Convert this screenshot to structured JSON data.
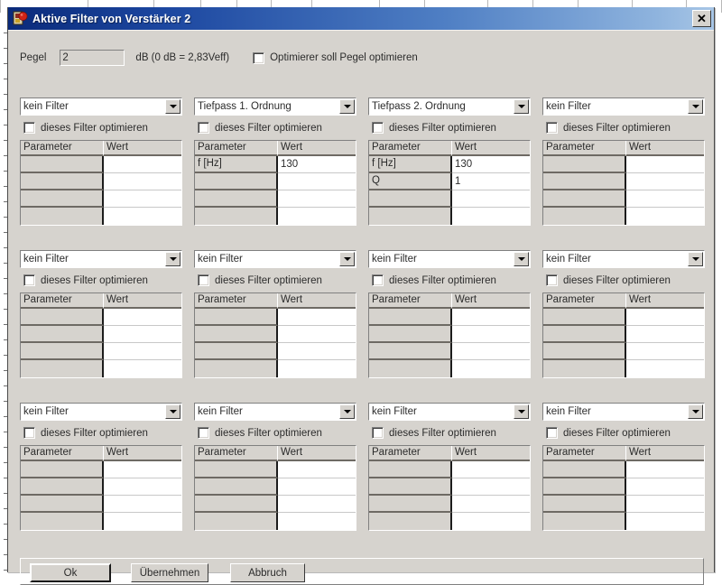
{
  "window": {
    "title": "Aktive Filter von Verstärker 2",
    "icon": "app-icon",
    "close_label": "✕"
  },
  "level": {
    "label": "Pegel",
    "value": "2",
    "placeholder": "",
    "unit": "dB (0 dB = 2,83Veff)",
    "optimize_checkbox": {
      "label": "Optimierer soll Pegel optimieren",
      "checked": false
    }
  },
  "filters": {
    "optimize_label": "dieses Filter optimieren",
    "columns": [
      "Parameter",
      "Wert"
    ],
    "blocks": [
      {
        "selected": "kein Filter",
        "optimize": false,
        "rows": []
      },
      {
        "selected": "Tiefpass 1. Ordnung",
        "optimize": false,
        "rows": [
          {
            "parameter": "f [Hz]",
            "wert": "130"
          }
        ]
      },
      {
        "selected": "Tiefpass 2. Ordnung",
        "optimize": false,
        "rows": [
          {
            "parameter": "f [Hz]",
            "wert": "130"
          },
          {
            "parameter": "Q",
            "wert": "1"
          }
        ]
      },
      {
        "selected": "kein Filter",
        "optimize": false,
        "rows": []
      },
      {
        "selected": "kein Filter",
        "optimize": false,
        "rows": []
      },
      {
        "selected": "kein Filter",
        "optimize": false,
        "rows": []
      },
      {
        "selected": "kein Filter",
        "optimize": false,
        "rows": []
      },
      {
        "selected": "kein Filter",
        "optimize": false,
        "rows": []
      },
      {
        "selected": "kein Filter",
        "optimize": false,
        "rows": []
      },
      {
        "selected": "kein Filter",
        "optimize": false,
        "rows": []
      },
      {
        "selected": "kein Filter",
        "optimize": false,
        "rows": []
      },
      {
        "selected": "kein Filter",
        "optimize": false,
        "rows": []
      }
    ]
  },
  "buttons": {
    "ok": "Ok",
    "apply": "Übernehmen",
    "cancel": "Abbruch"
  },
  "colors": {
    "titlebar_start": "#0a2a7a",
    "titlebar_end": "#a8c6e6",
    "dialog_face": "#d6d3ce",
    "field_white": "#ffffff",
    "text": "#2b2b2b"
  }
}
